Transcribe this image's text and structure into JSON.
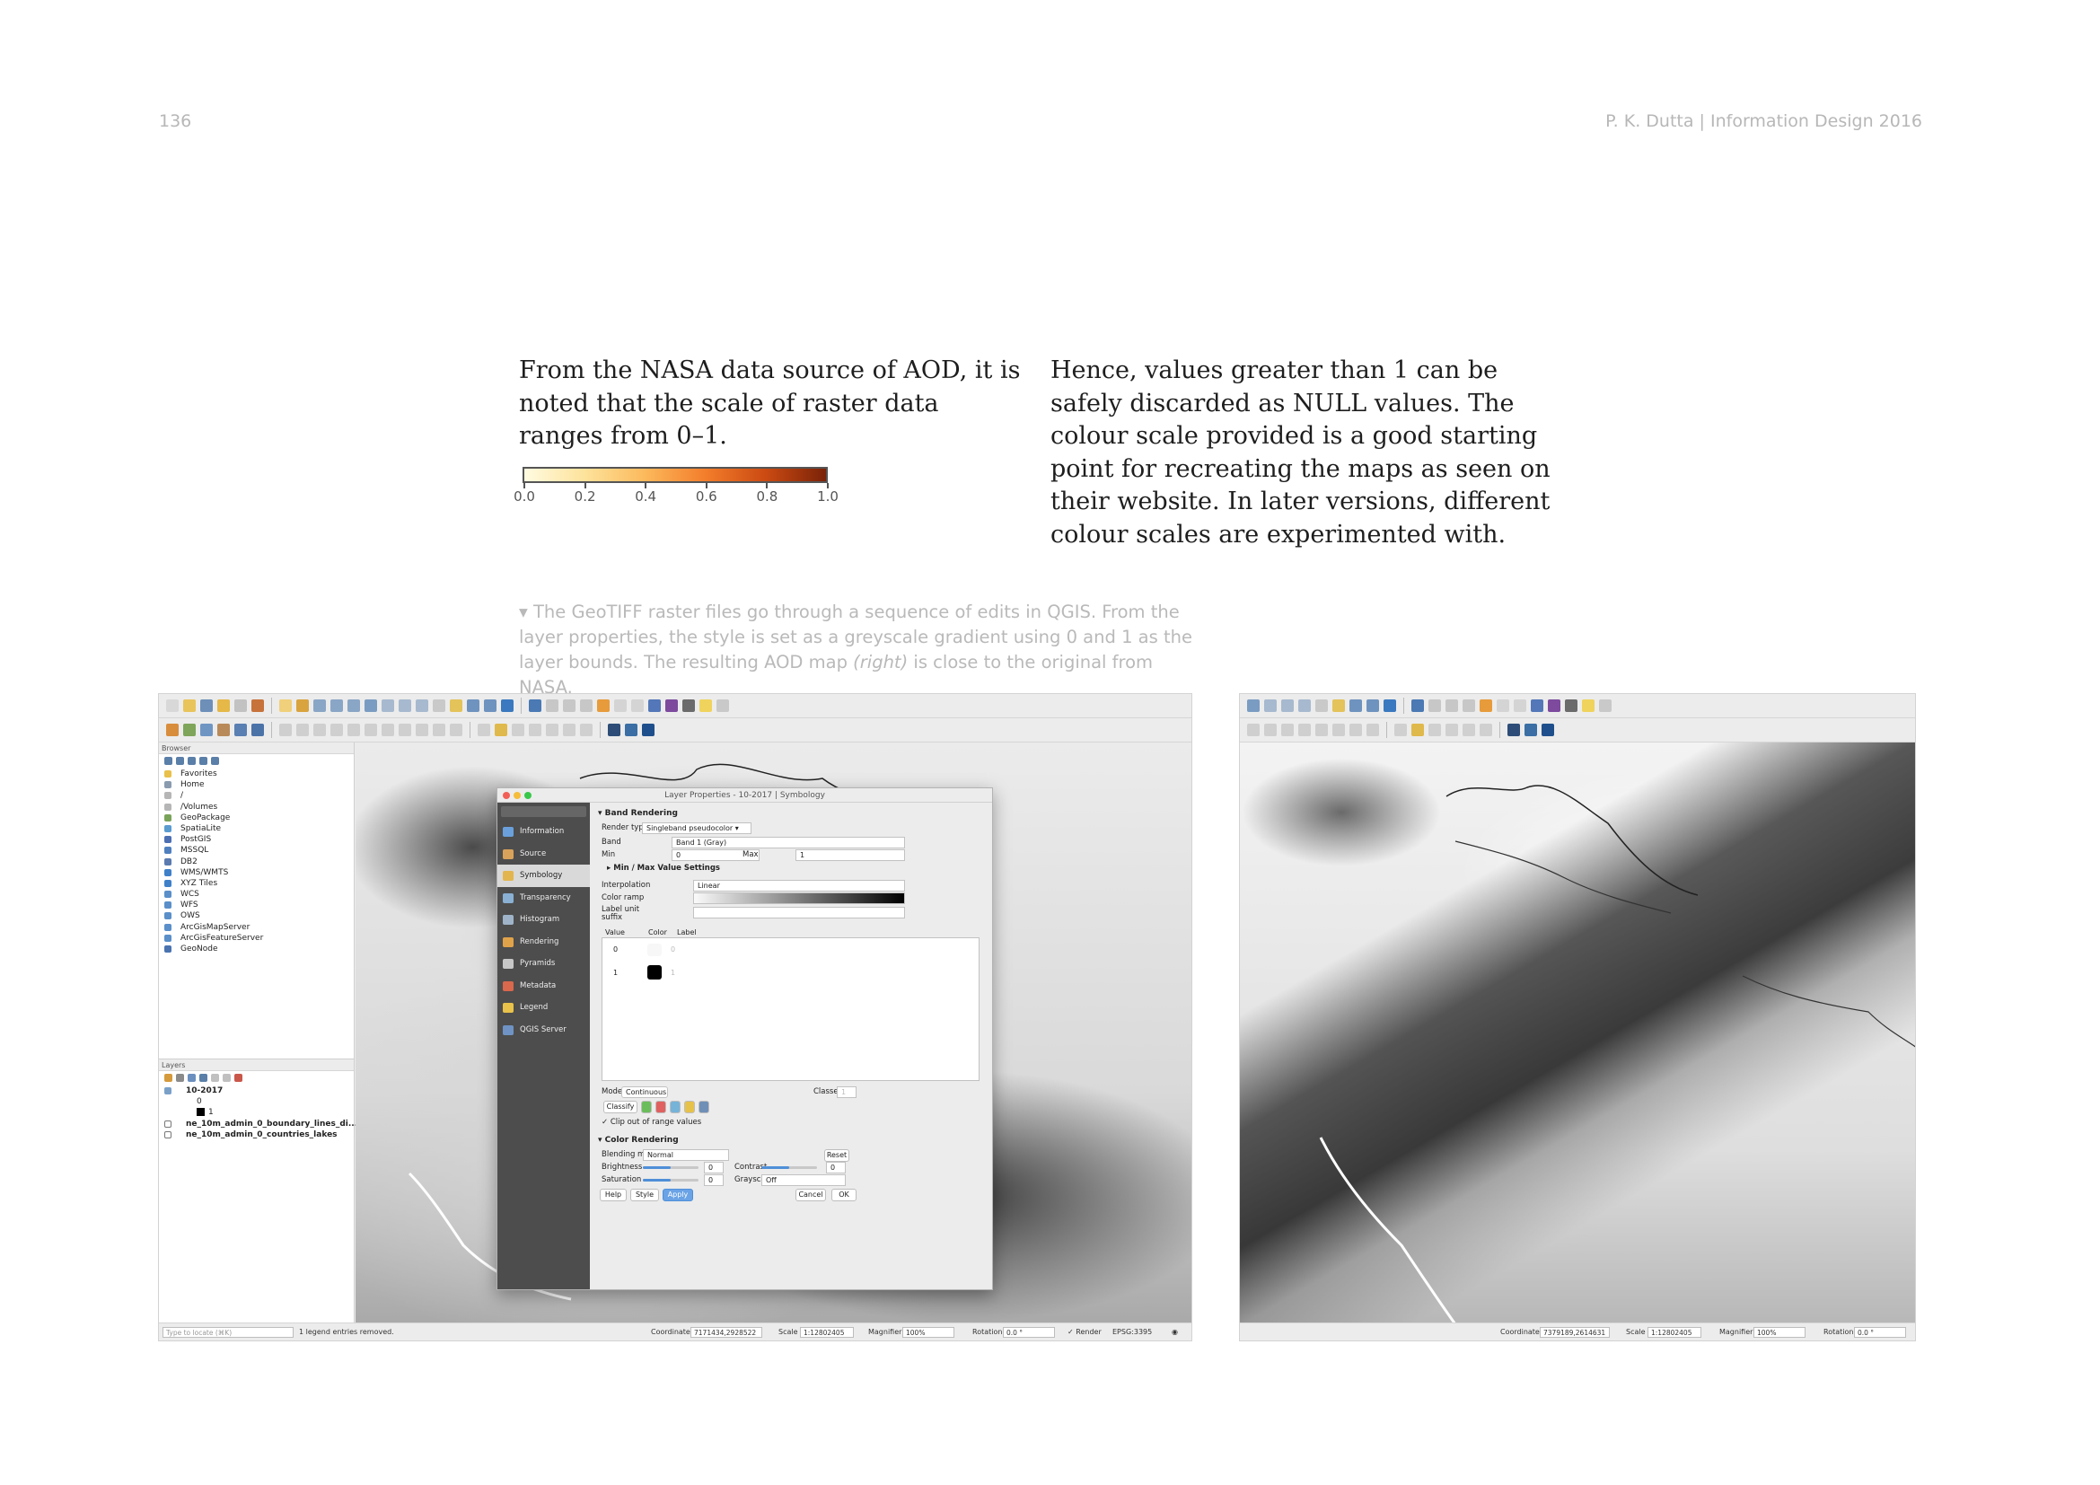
{
  "page": {
    "number": "136",
    "running_head": "P. K. Dutta | Information Design 2016"
  },
  "body": {
    "left_paragraph": "From the NASA data source of AOD, it is noted that the scale of raster data ranges from 0–1.",
    "right_paragraph": "Hence, values greater than 1 can be safely discarded as NULL values. The colour scale provided is a good starting point for recreating the maps as seen on their website. In later versions, different colour scales are experimented with."
  },
  "colour_scale": {
    "labels": [
      "0.0",
      "0.2",
      "0.4",
      "0.6",
      "0.8",
      "1.0"
    ],
    "colors": [
      "#fffbe1",
      "#fde39b",
      "#fcb95c",
      "#f37d2b",
      "#cb4a12",
      "#7a2208"
    ]
  },
  "caption": {
    "marker": "▾",
    "part1": "The GeoTIFF raster files go through a sequence of edits in QGIS. From the layer properties, the style is set as a greyscale gradient using 0 and 1 as the layer bounds. The resulting AOD map ",
    "italic": "(right)",
    "part2": " is close to the original from NASA."
  },
  "qgis": {
    "browser_title": "Browser",
    "browser_items": [
      "Favorites",
      "Home",
      "/",
      "/Volumes",
      "GeoPackage",
      "SpatiaLite",
      "PostGIS",
      "MSSQL",
      "DB2",
      "WMS/WMTS",
      "XYZ Tiles",
      "WCS",
      "WFS",
      "OWS",
      "ArcGisMapServer",
      "ArcGisFeatureServer",
      "GeoNode"
    ],
    "layers_title": "Layers",
    "layers": [
      "10-2017",
      "0",
      "1",
      "ne_10m_admin_0_boundary_lines_di...",
      "ne_10m_admin_0_countries_lakes"
    ],
    "locate_placeholder": "Type to locate (⌘K)",
    "status_message": "1 legend entries removed.",
    "status": {
      "coordinate_label": "Coordinate",
      "coordinate_value": "7171434,2928522",
      "scale_label": "Scale",
      "scale_value": "1:12802405",
      "magnifier_label": "Magnifier",
      "magnifier_value": "100%",
      "rotation_label": "Rotation",
      "rotation_value": "0.0 °",
      "render_label": "Render",
      "crs": "EPSG:3395"
    },
    "dialog": {
      "title": "Layer Properties - 10-2017 | Symbology",
      "sidebar": [
        "Information",
        "Source",
        "Symbology",
        "Transparency",
        "Histogram",
        "Rendering",
        "Pyramids",
        "Metadata",
        "Legend",
        "QGIS Server"
      ],
      "band_rendering": "Band Rendering",
      "render_type_label": "Render type",
      "render_type_value": "Singleband pseudocolor",
      "band_label": "Band",
      "band_value": "Band 1 (Gray)",
      "min_label": "Min",
      "min_value": "0",
      "max_label": "Max",
      "max_value": "1",
      "minmax_settings": "Min / Max Value Settings",
      "interpolation_label": "Interpolation",
      "interpolation_value": "Linear",
      "color_ramp_label": "Color ramp",
      "label_unit_suffix": "Label unit suffix",
      "col_value": "Value",
      "col_color": "Color",
      "col_label": "Label",
      "entries": [
        {
          "value": "0",
          "label": "0",
          "color": "#f7f7f7"
        },
        {
          "value": "1",
          "label": "1",
          "color": "#000000"
        }
      ],
      "mode_label": "Mode",
      "mode_value": "Continuous",
      "classes_label": "Classes",
      "classes_value": "1",
      "classify_button": "Classify",
      "clip_label": "Clip out of range values",
      "color_rendering": "Color Rendering",
      "blending_label": "Blending mode",
      "blending_value": "Normal",
      "reset_button": "Reset",
      "brightness_label": "Brightness",
      "brightness_value": "0",
      "contrast_label": "Contrast",
      "contrast_value": "0",
      "saturation_label": "Saturation",
      "saturation_value": "0",
      "grayscale_label": "Grayscale",
      "grayscale_value": "Off",
      "help_button": "Help",
      "style_button": "Style",
      "apply_button": "Apply",
      "cancel_button": "Cancel",
      "ok_button": "OK"
    },
    "right_status": {
      "coordinate_label": "Coordinate",
      "coordinate_value": "7379189,2614631",
      "scale_label": "Scale",
      "scale_value": "1:12802405",
      "magnifier_label": "Magnifier",
      "magnifier_value": "100%",
      "rotation_label": "Rotation",
      "rotation_value": "0.0 °"
    }
  }
}
